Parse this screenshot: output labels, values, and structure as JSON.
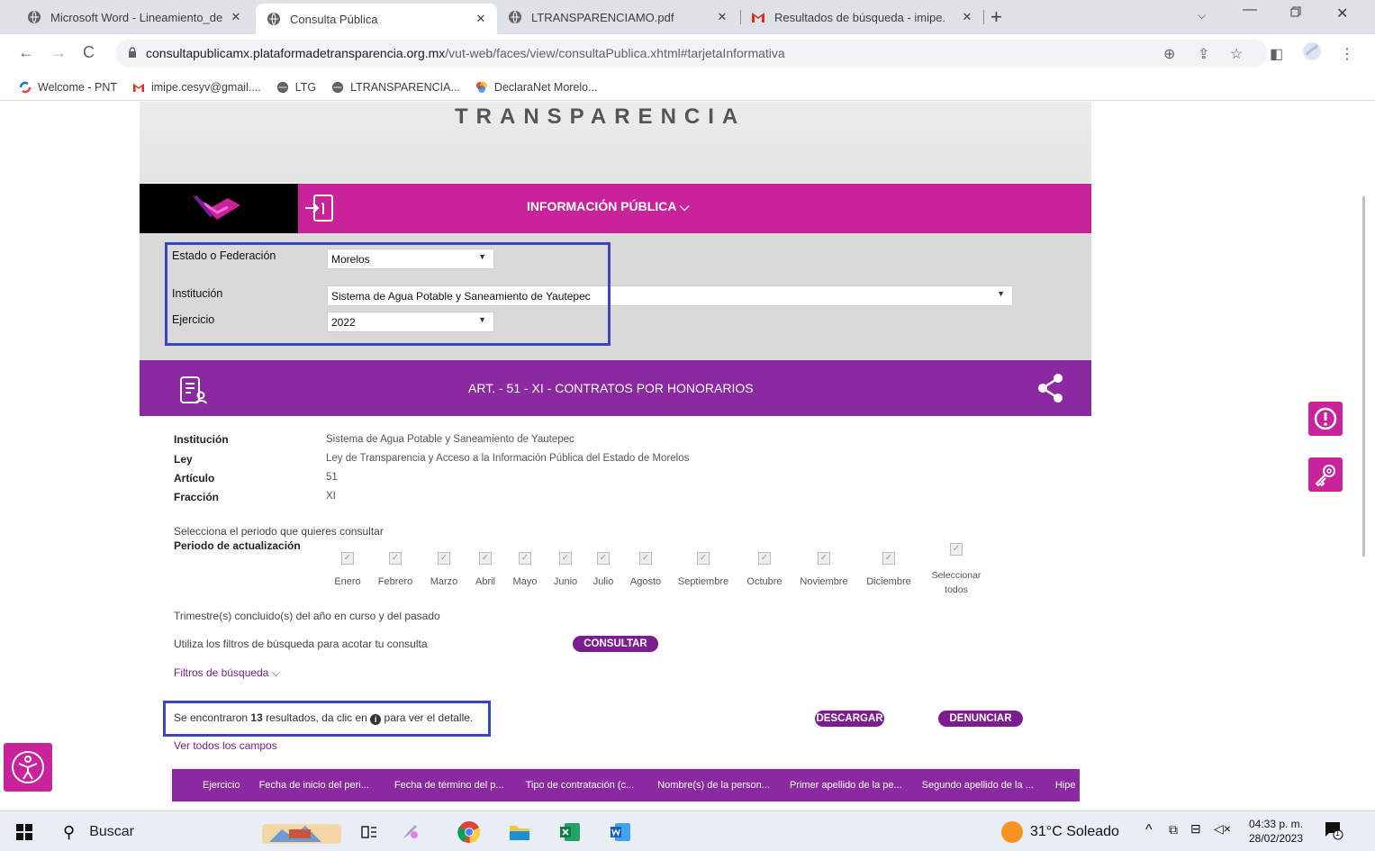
{
  "browser": {
    "tabs": [
      {
        "title": "Microsoft Word - Lineamiento_de",
        "close": "✕"
      },
      {
        "title": "Consulta Pública",
        "close": "✕"
      },
      {
        "title": "LTRANSPARENCIAMO.pdf",
        "close": "✕"
      },
      {
        "title": "Resultados de búsqueda - imipe.",
        "close": "✕"
      }
    ],
    "url_host": "consultapublicamx.plataformadetransparencia.org.mx",
    "url_path": "/vut-web/faces/view/consultaPublica.xhtml#tarjetaInformativa",
    "bookmarks": [
      "Welcome - PNT",
      "imipe.cesyv@gmail....",
      "LTG",
      "LTRANSPARENCIA...",
      "DeclaraNet Morelo..."
    ]
  },
  "page": {
    "brand": "TRANSPARENCIA",
    "info_bar_title": "INFORMACIÓN PÚBLICA",
    "filters": {
      "estado_label": "Estado o Federación",
      "estado_value": "Morelos",
      "institucion_label": "Institución",
      "institucion_value": "Sistema de Agua Potable y Saneamiento de Yautepec",
      "ejercicio_label": "Ejercicio",
      "ejercicio_value": "2022"
    },
    "article_title": "ART. - 51 - XI - CONTRATOS POR HONORARIOS",
    "details": {
      "institucion_label": "Institución",
      "institucion_value": "Sistema de Agua Potable y Saneamiento de Yautepec",
      "ley_label": "Ley",
      "ley_value": "Ley de Transparencia y Acceso a la Información Pública del Estado de Morelos",
      "articulo_label": "Artículo",
      "articulo_value": "51",
      "fraccion_label": "Fracción",
      "fraccion_value": "XI"
    },
    "period_prompt": "Selecciona el periodo que quieres consultar",
    "period_label": "Periodo de actualización",
    "months": [
      "Enero",
      "Febrero",
      "Marzo",
      "Abril",
      "Mayo",
      "Junio",
      "Julio",
      "Agosto",
      "Septiembre",
      "Octubre",
      "Noviembre",
      "Diciembre"
    ],
    "select_all_line1": "Seleccionar",
    "select_all_line2": "todos",
    "trimestre_note": "Trimestre(s) concluido(s) del año en curso y del pasado",
    "filters_hint": "Utiliza los filtros de búsqueda para acotar tu consulta",
    "consultar_button": "CONSULTAR",
    "filtros_link": "Filtros de búsqueda",
    "results_prefix": "Se encontraron",
    "results_count": "13",
    "results_suffix_a": "resultados, da clic en",
    "results_suffix_b": "para ver el detalle.",
    "descargar_button": "DESCARGAR",
    "denunciar_button": "DENUNCIAR",
    "ver_todos_link": "Ver todos los campos",
    "table_headers": [
      "Ejercicio",
      "Fecha de inicio del peri...",
      "Fecha de término del p...",
      "Tipo de contratación (c...",
      "Nombre(s) de la person...",
      "Primer apellido de la pe...",
      "Segundo apellido de la ...",
      "Hipe"
    ]
  },
  "taskbar": {
    "search_placeholder": "Buscar",
    "weather": "31°C Soleado",
    "time": "04:33 p. m.",
    "date": "28/02/2023",
    "notification_count": "1"
  },
  "colors": {
    "magenta": "#c8239a",
    "purple": "#8b2aa0",
    "highlight_box": "#3b45c4"
  }
}
